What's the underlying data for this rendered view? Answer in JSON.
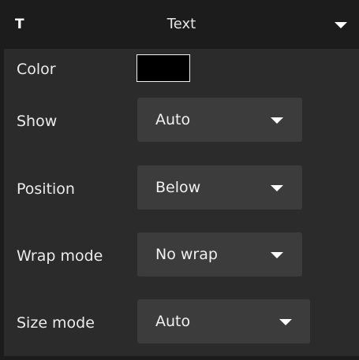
{
  "header": {
    "icon": "text-format-icon",
    "icon_glyph": "T",
    "title": "Text",
    "collapse_icon": "chevron-down-icon"
  },
  "color_row": {
    "label": "Color",
    "value": "#000000"
  },
  "show_row": {
    "label": "Show",
    "value": "Auto"
  },
  "position_row": {
    "label": "Position",
    "value": "Below"
  },
  "wrap_row": {
    "label": "Wrap mode",
    "value": "No wrap"
  },
  "size_row": {
    "label": "Size mode",
    "value": "Auto"
  },
  "colors": {
    "panel_bg": "#2b2b2b",
    "header_bg": "#1c1c1c",
    "select_bg": "#3c3c3c",
    "text": "#ebebeb"
  }
}
